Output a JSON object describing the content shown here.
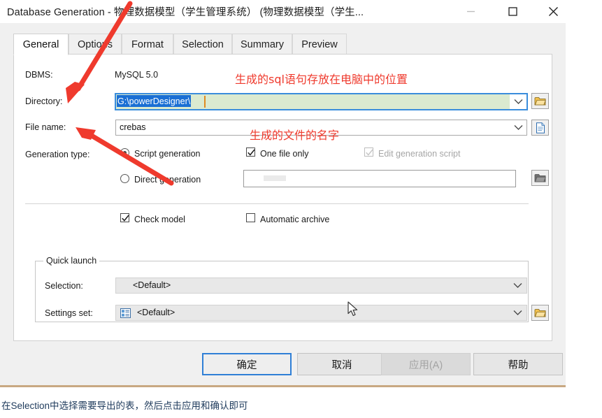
{
  "window": {
    "title": "Database Generation - 物理数据模型（学生管理系统） (物理数据模型（学生...",
    "controls": {
      "minimize": "minimize-icon",
      "maximize": "maximize-icon",
      "close": "close-icon"
    }
  },
  "tabs": [
    {
      "label": "General",
      "active": true
    },
    {
      "label": "Options",
      "active": false
    },
    {
      "label": "Format",
      "active": false
    },
    {
      "label": "Selection",
      "active": false
    },
    {
      "label": "Summary",
      "active": false
    },
    {
      "label": "Preview",
      "active": false
    }
  ],
  "form": {
    "dbms": {
      "label": "DBMS:",
      "value": "MySQL 5.0"
    },
    "directory": {
      "label": "Directory:",
      "value": "G:\\powerDesigner\\",
      "selected_text": "G:\\powerDesigner\\",
      "browse_icon": "folder-icon"
    },
    "file_name": {
      "label": "File name:",
      "value": "crebas",
      "browse_icon": "document-icon"
    },
    "generation_type": {
      "label": "Generation type:",
      "options": [
        {
          "label": "Script generation",
          "selected": true
        },
        {
          "label": "Direct generation",
          "selected": false
        }
      ]
    },
    "one_file_only": {
      "label": "One file only",
      "checked": true,
      "enabled": true
    },
    "edit_generation_script": {
      "label": "Edit generation script",
      "checked": true,
      "enabled": false
    },
    "script_path": {
      "value": "",
      "browse_icon": "folder-open-icon",
      "enabled": false
    },
    "check_model": {
      "label": "Check model",
      "checked": true,
      "enabled": true
    },
    "automatic_archive": {
      "label": "Automatic archive",
      "checked": false,
      "enabled": true
    }
  },
  "quick_launch": {
    "title": "Quick launch",
    "selection": {
      "label": "Selection:",
      "value": "<Default>"
    },
    "settings_set": {
      "label": "Settings set:",
      "value": "<Default>",
      "value_icon": "list-settings-icon",
      "browse_icon": "folder-icon"
    }
  },
  "buttons": [
    {
      "label": "确定",
      "state": "default"
    },
    {
      "label": "取消",
      "state": "normal"
    },
    {
      "label": "应用(A)",
      "state": "disabled"
    },
    {
      "label": "帮助",
      "state": "normal"
    }
  ],
  "annotations": {
    "color": "#ef3a2d",
    "directory_note": "生成的sql语句存放在电脑中的位置",
    "filename_note": "生成的文件的名字"
  },
  "caption": "在Selection中选择需要导出的表，然后点击应用和确认即可"
}
